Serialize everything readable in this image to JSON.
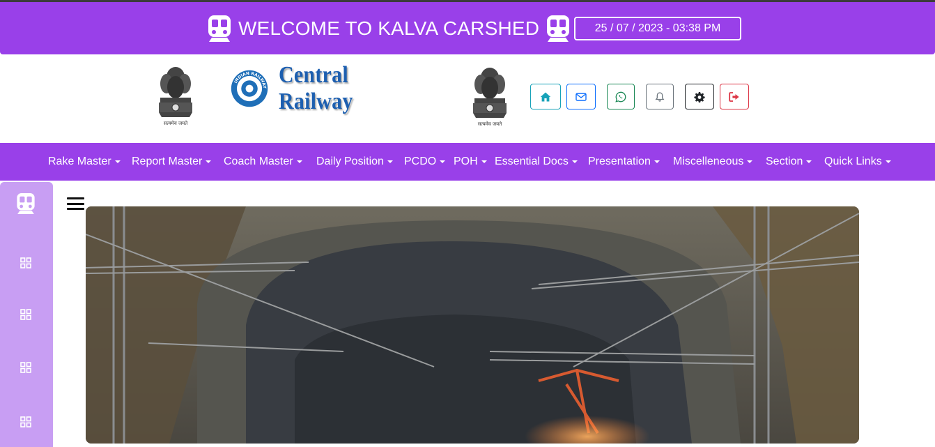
{
  "topbar": {
    "welcome_text": "WELCOME TO KALVA CARSHED",
    "datetime": "25 / 07 / 2023 - 03:38 PM",
    "bg_color": "#9940e9",
    "icons": [
      "train-icon"
    ]
  },
  "header": {
    "emblem_motto": "सत्यमेव जयते",
    "logo_text": "Central Railway",
    "logo_ring_text": "INDIAN RAILWAYS",
    "buttons": [
      {
        "name": "home",
        "icon": "home-icon",
        "color": "#17a2b8"
      },
      {
        "name": "mail",
        "icon": "envelope-icon",
        "color": "#0d6efd"
      },
      {
        "name": "whatsapp",
        "icon": "whatsapp-icon",
        "color": "#198754"
      },
      {
        "name": "notifications",
        "icon": "bell-icon",
        "color": "#6c757d"
      },
      {
        "name": "settings",
        "icon": "gear-icon",
        "color": "#212529"
      },
      {
        "name": "logout",
        "icon": "sign-out-icon",
        "color": "#dc3545"
      }
    ]
  },
  "nav": {
    "items": [
      "Rake Master",
      "Report Master",
      "Coach Master",
      "Daily Position",
      "PCDO",
      "POH",
      "Essential Docs",
      "Presentation",
      "Miscelleneous",
      "Section",
      "Quick Links"
    ]
  },
  "sidebar": {
    "bg_color": "#c89ef3",
    "icons": [
      "train-icon",
      "grid-icon",
      "grid-icon",
      "grid-icon",
      "grid-icon"
    ]
  },
  "main": {
    "menu_icon": "hamburger-icon",
    "hero_image": "railway-tunnel-photo"
  }
}
